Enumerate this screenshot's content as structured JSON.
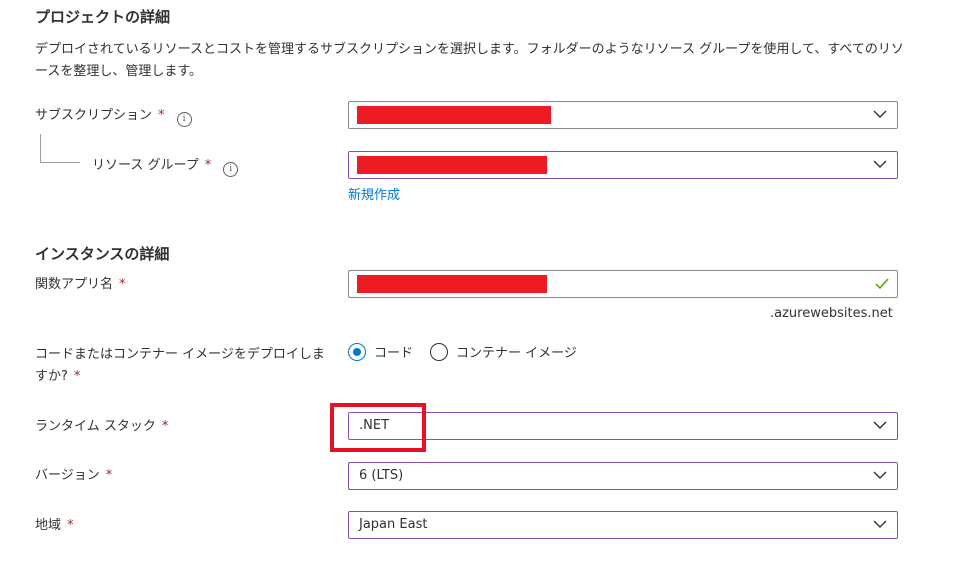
{
  "project": {
    "heading": "プロジェクトの詳細",
    "description": "デプロイされているリソースとコストを管理するサブスクリプションを選択します。フォルダーのようなリソース グループを使用して、すべてのリソースを整理し、管理します。",
    "subscription_label": "サブスクリプション",
    "resource_group_label": "リソース グループ",
    "new_create_link": "新規作成"
  },
  "instance": {
    "heading": "インスタンスの詳細",
    "function_app_label": "関数アプリ名",
    "domain_suffix": ".azurewebsites.net",
    "deploy_question": "コードまたはコンテナー イメージをデプロイしますか?",
    "deploy_options": [
      "コード",
      "コンテナー イメージ"
    ],
    "deploy_selected": "コード",
    "runtime_label": "ランタイム スタック",
    "runtime_value": ".NET",
    "version_label": "バージョン",
    "version_value": "6 (LTS)",
    "region_label": "地域",
    "region_value": "Japan East"
  },
  "required_marker": "*",
  "info_glyph": "i",
  "colors": {
    "accent": "#0078d4",
    "required": "#a4262c",
    "redaction": "#ed1c24",
    "highlight": "#e81123",
    "valid_check": "#57a300"
  }
}
